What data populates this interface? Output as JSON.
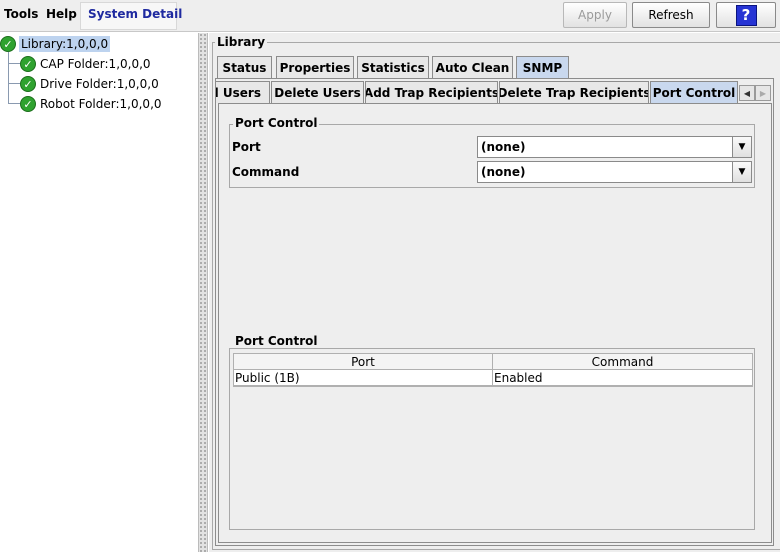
{
  "menu": {
    "tools": "Tools",
    "help": "Help",
    "system_detail": "System Detail"
  },
  "toolbar": {
    "apply": "Apply",
    "refresh": "Refresh",
    "help_symbol": "?"
  },
  "tree": {
    "root": "Library:1,0,0,0",
    "children": [
      "CAP Folder:1,0,0,0",
      "Drive Folder:1,0,0,0",
      "Robot Folder:1,0,0,0"
    ]
  },
  "panel": {
    "group_title": "Library",
    "tabs": [
      "Status",
      "Properties",
      "Statistics",
      "Auto Clean",
      "SNMP"
    ],
    "selected_tab": "SNMP",
    "subtabs": [
      "d Users",
      "Delete Users",
      "Add Trap Recipients",
      "Delete Trap Recipients",
      "Port Control"
    ],
    "selected_subtab": "Port Control"
  },
  "port_control_form": {
    "title": "Port Control",
    "port_label": "Port",
    "port_value": "(none)",
    "command_label": "Command",
    "command_value": "(none)"
  },
  "port_control_table": {
    "title": "Port Control",
    "columns": [
      "Port",
      "Command"
    ],
    "rows": [
      [
        "Public (1B)",
        "Enabled"
      ]
    ]
  },
  "icons": {
    "status": "check-circle-icon",
    "dropdown": "chevron-down-icon",
    "scroll_left": "arrow-left-icon",
    "scroll_right": "arrow-right-icon"
  }
}
